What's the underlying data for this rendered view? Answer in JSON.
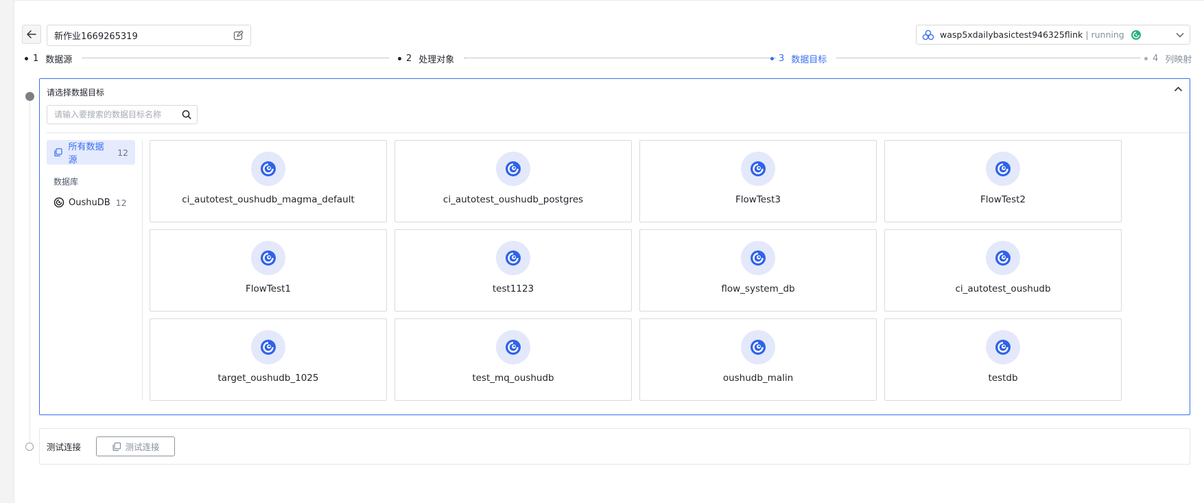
{
  "header": {
    "job_name": "新作业1669265319",
    "engine_name": "wasp5xdailybasictest946325flink",
    "engine_status": "| running"
  },
  "steps": [
    {
      "num": "1",
      "label": "数据源",
      "state": "done"
    },
    {
      "num": "2",
      "label": "处理对象",
      "state": "done"
    },
    {
      "num": "3",
      "label": "数据目标",
      "state": "active"
    },
    {
      "num": "4",
      "label": "列映射",
      "state": "next"
    }
  ],
  "panel": {
    "title": "请选择数据目标",
    "search_placeholder": "请输入要搜索的数据目标名称",
    "sidebar": {
      "all_label": "所有数据源",
      "all_count": "12",
      "group_label": "数据库",
      "items": [
        {
          "label": "OushuDB",
          "count": "12"
        }
      ]
    },
    "cards": [
      "ci_autotest_oushudb_magma_default",
      "ci_autotest_oushudb_postgres",
      "FlowTest3",
      "FlowTest2",
      "FlowTest1",
      "test1123",
      "flow_system_db",
      "ci_autotest_oushudb",
      "target_oushudb_1025",
      "test_mq_oushudb",
      "oushudb_malin",
      "testdb"
    ]
  },
  "test_connection": {
    "label": "测试连接",
    "button_label": "测试连接"
  },
  "colors": {
    "accent": "#3a6ff2",
    "running": "#2bb07f",
    "logo_bg": "#e4e8fb"
  }
}
